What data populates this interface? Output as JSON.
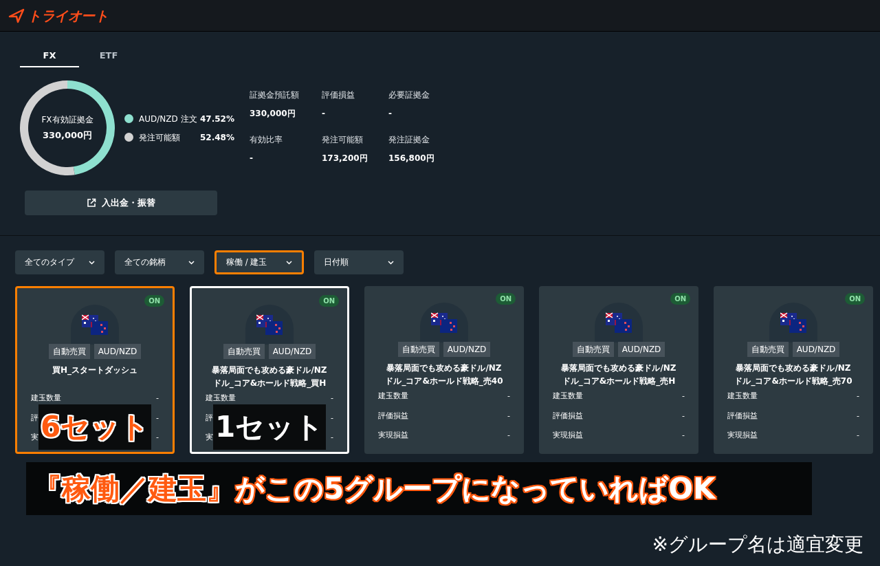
{
  "logo": {
    "text": "トライオート"
  },
  "tabs": [
    {
      "label": "FX",
      "selected": true
    },
    {
      "label": "ETF",
      "selected": false
    }
  ],
  "summary": {
    "title": "FX有効証拠金",
    "amount": "330,000円",
    "chart_data": {
      "type": "donut",
      "categories": [
        "AUD/NZD 注文",
        "発注可能額"
      ],
      "values": [
        47.52,
        52.48
      ]
    }
  },
  "legend": [
    {
      "value": "47.52%",
      "color": "#8ee0cf"
    },
    {
      "value": "52.48%",
      "color": "#d2d2d2"
    }
  ],
  "stats": [
    {
      "label": "証拠金預託額",
      "value": "330,000円"
    },
    {
      "label": "評価損益",
      "value": "-"
    },
    {
      "label": "必要証拠金",
      "value": "-"
    },
    {
      "label": "有効比率",
      "value": "-"
    },
    {
      "label": "発注可能額",
      "value": "173,200円"
    },
    {
      "label": "発注証拠金",
      "value": "156,800円"
    }
  ],
  "transfer_button": {
    "label": "入出金・振替"
  },
  "filters": [
    {
      "label": "全てのタイプ"
    },
    {
      "label": "全ての銘柄"
    },
    {
      "label": "稼働 / 建玉",
      "color": "#ff7f00"
    },
    {
      "label": "日付順"
    }
  ],
  "cards": [
    {
      "status": "ON",
      "tags": [
        "自動売買",
        "AUD/NZD"
      ],
      "title": [
        "買H_スタートダッシュ"
      ],
      "rows": [
        {
          "label": "建玉数量",
          "value": "-"
        },
        {
          "label": "評",
          "value": "-"
        },
        {
          "label": "実",
          "value": "-"
        }
      ],
      "color": "#ff7f00",
      "callout": {
        "text": "6セット",
        "kind": "orange"
      }
    },
    {
      "status": "ON",
      "tags": [
        "自動売買",
        "AUD/NZD"
      ],
      "title": [
        "暴落局面でも攻める豪ドル/NZ",
        "ドル_コア&ホールド戦略_買H"
      ],
      "rows": [
        {
          "label": "建玉数量",
          "value": "-"
        },
        {
          "label": "評",
          "value": "-"
        },
        {
          "label": "実",
          "value": "-"
        }
      ],
      "color": "#ffffff",
      "callout": {
        "text": "1セット",
        "kind": "white"
      }
    },
    {
      "status": "ON",
      "tags": [
        "自動売買",
        "AUD/NZD"
      ],
      "title": [
        "暴落局面でも攻める豪ドル/NZ",
        "ドル_コア&ホールド戦略_売40"
      ],
      "rows": [
        {
          "label": "建玉数量",
          "value": "-"
        },
        {
          "label": "評価損益",
          "value": "-"
        },
        {
          "label": "実現損益",
          "value": "-"
        }
      ]
    },
    {
      "status": "ON",
      "tags": [
        "自動売買",
        "AUD/NZD"
      ],
      "title": [
        "暴落局面でも攻める豪ドル/NZ",
        "ドル_コア&ホールド戦略_売H"
      ],
      "rows": [
        {
          "label": "建玉数量",
          "value": "-"
        },
        {
          "label": "評価損益",
          "value": "-"
        },
        {
          "label": "実現損益",
          "value": "-"
        }
      ]
    },
    {
      "status": "ON",
      "tags": [
        "自動売買",
        "AUD/NZD"
      ],
      "title": [
        "暴落局面でも攻める豪ドル/NZ",
        "ドル_コア&ホールド戦略_売70"
      ],
      "rows": [
        {
          "label": "建玉数量",
          "value": "-"
        },
        {
          "label": "評価損益",
          "value": "-"
        },
        {
          "label": "実現損益",
          "value": "-"
        }
      ]
    }
  ],
  "caption": {
    "highlight": "『稼働／建玉』",
    "rest": "がこの5グループになっていればOK"
  },
  "note": "※グループ名は適宜変更"
}
